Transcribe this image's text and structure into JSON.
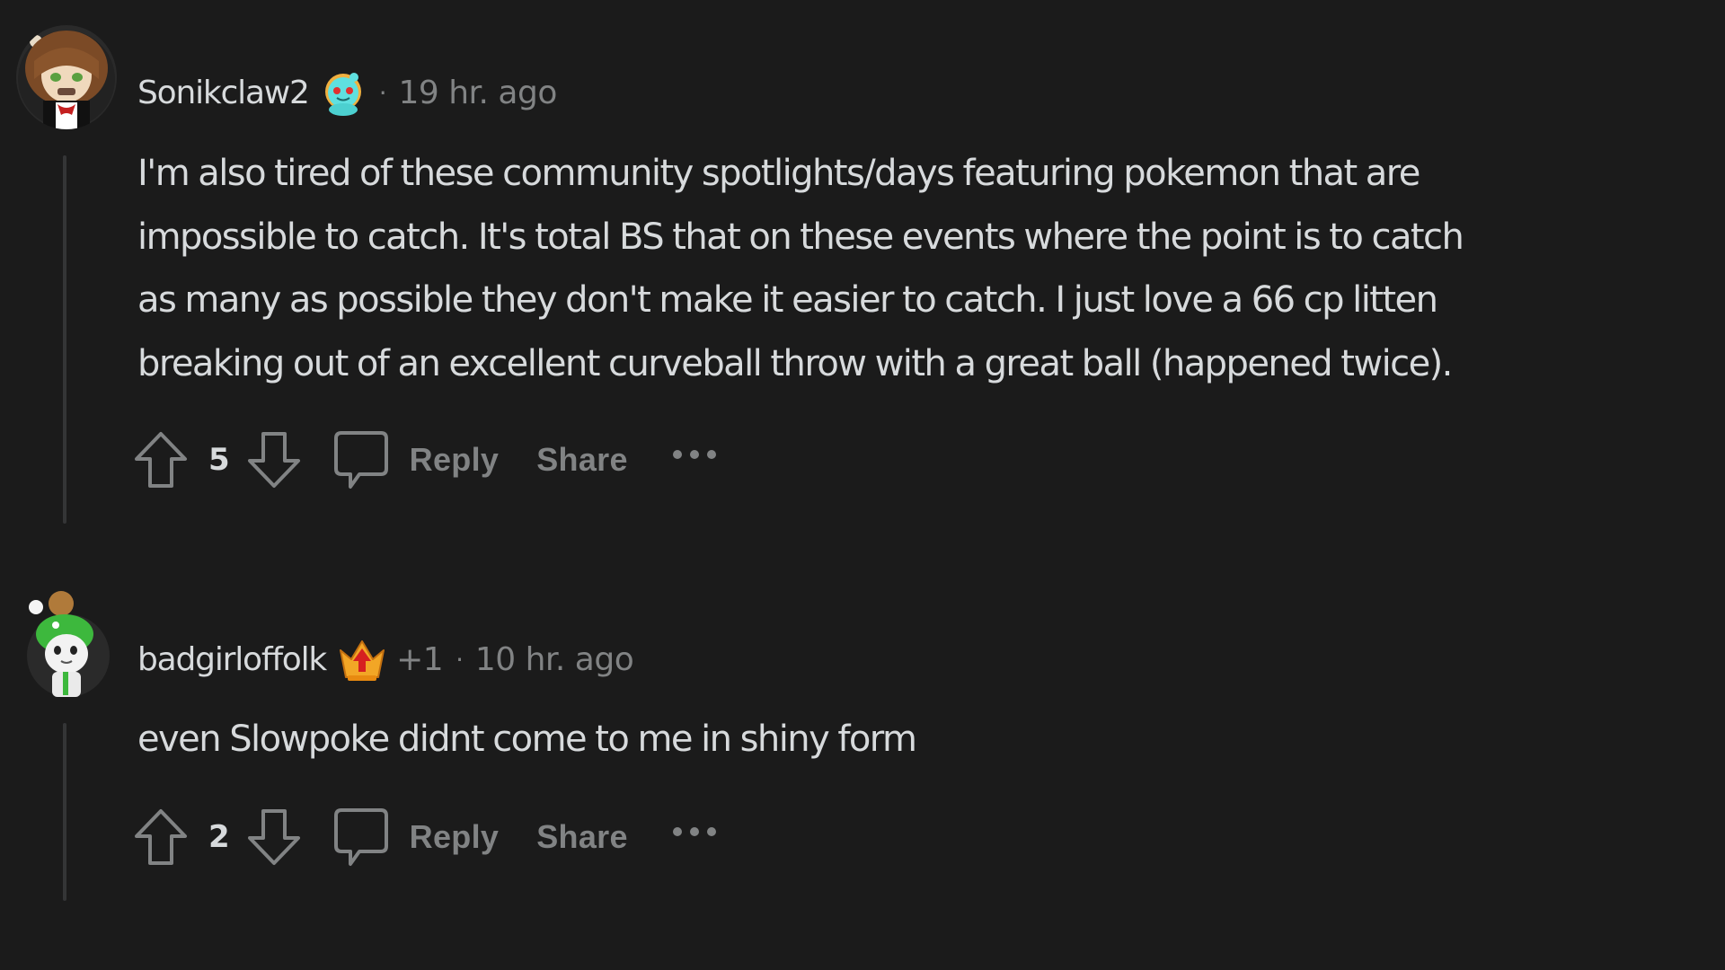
{
  "colors": {
    "background": "#1b1b1b",
    "text_primary": "#d7dadc",
    "text_secondary": "#818384",
    "thread_line": "#343536"
  },
  "comments": [
    {
      "username": "Sonikclaw2",
      "avatar_icon": "avatar-brown-curly-hair",
      "flair_icon": "snoo-cyan-flair-icon",
      "extra": "",
      "separator": "·",
      "timestamp": "19 hr. ago",
      "body_lines": [
        "I'm also tired of these community spotlights/days featuring pokemon that are",
        "impossible to catch. It's total BS that on these events where the point is to catch",
        "as many as possible they don't make it easier to catch. I just love a 66 cp litten",
        "breaking out of an excellent curveball throw with a great ball (happened twice)."
      ],
      "score": "5",
      "actions": {
        "reply": "Reply",
        "share": "Share",
        "more": "more-options"
      }
    },
    {
      "username": "badgirloffolk",
      "avatar_icon": "avatar-green-frog-hat",
      "flair_icon": "crown-achievement-icon",
      "extra": "+1",
      "separator": "·",
      "timestamp": "10 hr. ago",
      "body_lines": [
        "even Slowpoke didnt come to me in shiny form"
      ],
      "score": "2",
      "actions": {
        "reply": "Reply",
        "share": "Share",
        "more": "more-options"
      }
    }
  ]
}
